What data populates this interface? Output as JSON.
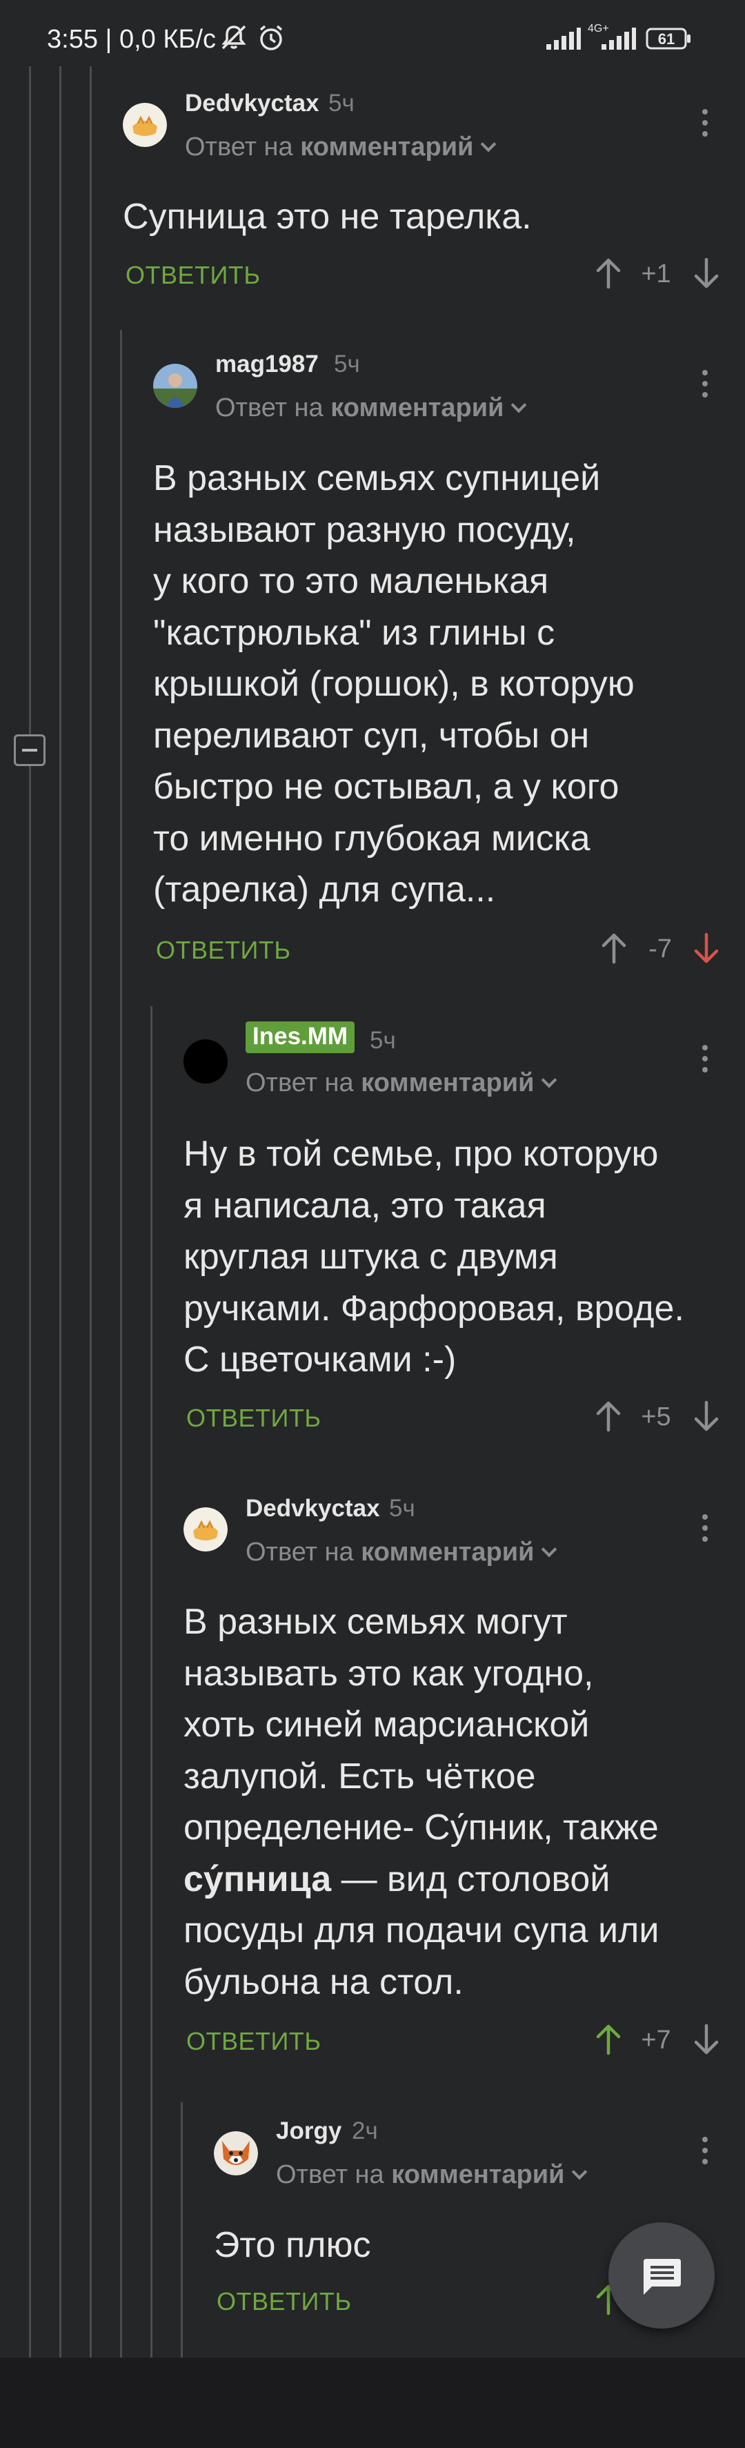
{
  "status_bar": {
    "time": "3:55",
    "separator": "|",
    "speed": "0,0 КБ/с",
    "network_label": "4G+",
    "battery": "61",
    "icons": [
      "mute-icon",
      "alarm-icon",
      "signal-icon",
      "signal-4g-icon",
      "battery-icon"
    ]
  },
  "reply_prefix": "Ответ на",
  "reply_target": "комментарий",
  "reply_button": "ОТВЕТИТЬ",
  "colors": {
    "background": "#252628",
    "accent_green": "#6eaa3f",
    "downvote_red": "#d9534a",
    "tag_green": "#5f9e3a"
  },
  "comments": [
    {
      "author": "Dedvkyctax",
      "time": "5ч",
      "body": "Супница это не тарелка.",
      "rating": "+1",
      "vote": "none"
    },
    {
      "author": "mag1987",
      "time": "5ч",
      "body": "В разных семьях супницей\nназывают разную посуду,\nу кого то это маленькая\n\"кастрюлька\" из глины с\nкрышкой (горшок), в которую\nпереливают суп, чтобы он\nбыстро не остывал, а у кого\nто именно глубокая миска\n(тарелка) для супа...",
      "rating": "-7",
      "vote": "down"
    },
    {
      "author": "Ines.MM",
      "time": "5ч",
      "body": "Ну в той семье, про которую\nя написала, это такая\nкруглая штука с двумя\nручками. Фарфоровая, вроде.\nС цветочками :-)",
      "rating": "+5",
      "vote": "none"
    },
    {
      "author": "Dedvkyctax",
      "time": "5ч",
      "body_before": "В разных семьях могут\nназывать это как угодно,\nхоть синей марсианской\nзалупой. Есть чёткое\nопределение- Су́пник, также\n",
      "body_bold": "су́пница",
      "body_after": " — вид столовой\nпосуды для подачи супа или\nбульона на стол.",
      "rating": "+7",
      "vote": "up"
    },
    {
      "author": "Jorgy",
      "time": "2ч",
      "body": "Это плюс",
      "rating": "",
      "vote": "up"
    }
  ],
  "fab": {
    "icon": "chat-icon"
  },
  "collapse_icon": "minus-icon"
}
